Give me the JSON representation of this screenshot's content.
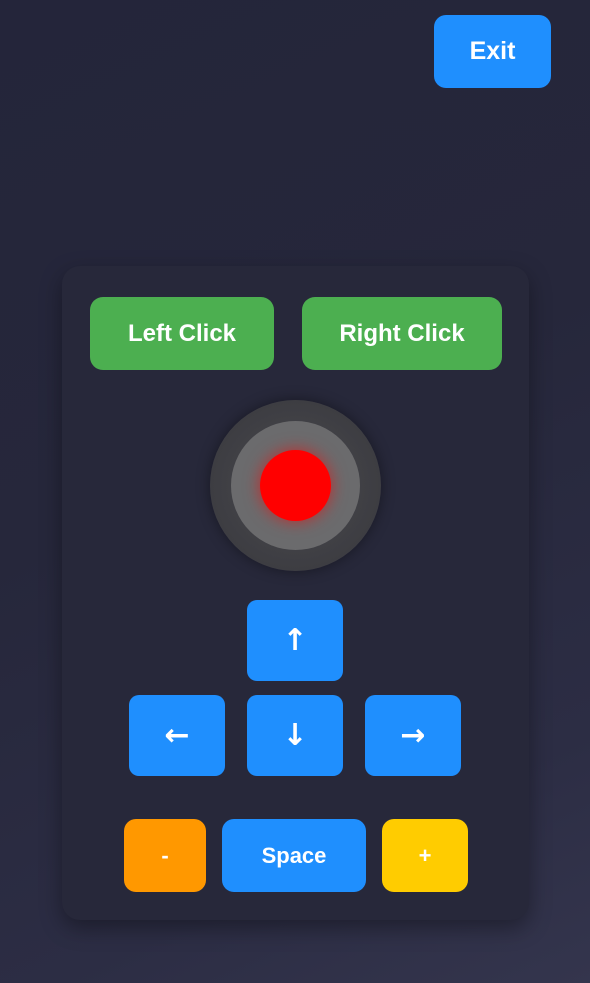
{
  "header": {
    "exit_label": "Exit"
  },
  "mouse_buttons": {
    "left_label": "Left Click",
    "right_label": "Right Click"
  },
  "joystick": {
    "knob_icon": "joystick-knob"
  },
  "arrows": {
    "up": "↑",
    "left": "←",
    "down": "↓",
    "right": "→"
  },
  "keys": {
    "minus_label": "-",
    "space_label": "Space",
    "plus_label": "+"
  },
  "colors": {
    "primary_blue": "#1f8ffe",
    "click_green": "#4caf50",
    "minus_orange": "#ff9800",
    "plus_yellow": "#ffcc00",
    "knob_red": "#ff0000"
  }
}
